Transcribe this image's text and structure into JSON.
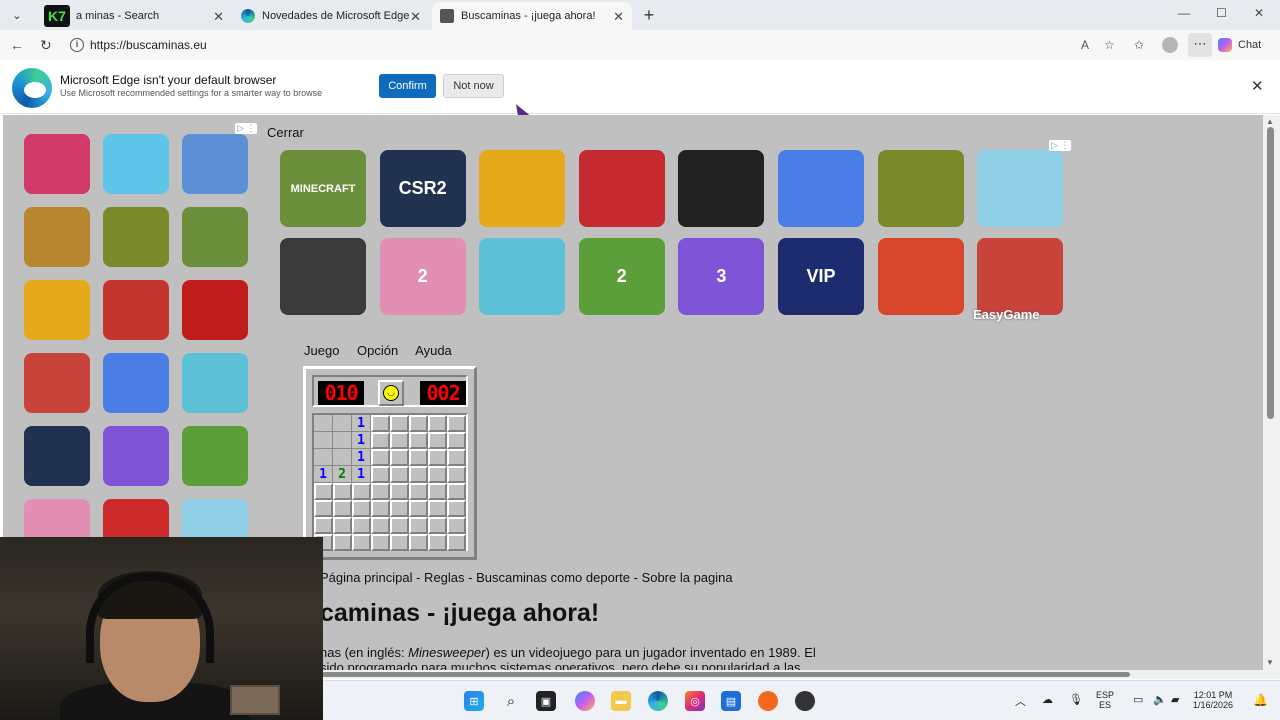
{
  "browser": {
    "tabs": [
      {
        "title": "a minas - Search",
        "logo_text": "K7"
      },
      {
        "title": "Novedades de Microsoft Edge"
      },
      {
        "title": "Buscaminas - ¡juega ahora!",
        "active": true
      }
    ],
    "url": "https://buscaminas.eu",
    "chat_label": "Chat"
  },
  "notification": {
    "title": "Microsoft Edge isn't your default browser",
    "subtitle": "Use Microsoft recommended settings for a smarter way to browse",
    "confirm_label": "Confirm",
    "not_now_label": "Not now"
  },
  "page": {
    "close_label": "Cerrar",
    "ad_brand": "EasyGame",
    "menu": [
      "Juego",
      "Opción",
      "Ayuda"
    ],
    "minesweeper": {
      "mines_counter": "010",
      "timer": "002",
      "rows": 8,
      "cols": 8,
      "opened_cells": [
        {
          "r": 0,
          "c": 0,
          "v": ""
        },
        {
          "r": 0,
          "c": 1,
          "v": ""
        },
        {
          "r": 0,
          "c": 2,
          "v": "1"
        },
        {
          "r": 1,
          "c": 0,
          "v": ""
        },
        {
          "r": 1,
          "c": 1,
          "v": ""
        },
        {
          "r": 1,
          "c": 2,
          "v": "1"
        },
        {
          "r": 2,
          "c": 0,
          "v": ""
        },
        {
          "r": 2,
          "c": 1,
          "v": ""
        },
        {
          "r": 2,
          "c": 2,
          "v": "1"
        },
        {
          "r": 3,
          "c": 0,
          "v": "1"
        },
        {
          "r": 3,
          "c": 1,
          "v": "2"
        },
        {
          "r": 3,
          "c": 2,
          "v": "1"
        }
      ],
      "number_colors": {
        "1": "#0000ff",
        "2": "#008000"
      }
    },
    "links": "Página principal - Reglas - Buscaminas como deporte - Sobre la pagina",
    "headline": "caminas - ¡juega ahora!",
    "paragraph_line1_a": "nas (en inglés: ",
    "paragraph_line1_em": "Minesweeper",
    "paragraph_line1_b": ") es un videojuego para un jugador inventado en 1989. El",
    "paragraph_line2": "sido programado para muchos sistemas operativos, pero debe su popularidad a las"
  },
  "sidebar_games": [
    {
      "name": "pokemon",
      "color": "#d23a6a"
    },
    {
      "name": "toca-world",
      "color": "#5fc5e8"
    },
    {
      "name": "hero-wars",
      "color": "#5b8fd6"
    },
    {
      "name": "clash-of-clans",
      "color": "#b8862e"
    },
    {
      "name": "temple-run",
      "color": "#7a8a2a"
    },
    {
      "name": "minecraft",
      "color": "#6b8f3a"
    },
    {
      "name": "geometry-dash",
      "color": "#e6a91a"
    },
    {
      "name": "free-fire",
      "color": "#c2362e"
    },
    {
      "name": "among-us",
      "color": "#c01c1c"
    },
    {
      "name": "subway-surfers",
      "color": "#c8443a"
    },
    {
      "name": "snake",
      "color": "#4a7ee6"
    },
    {
      "name": "archer",
      "color": "#5cc0d6"
    },
    {
      "name": "csr2",
      "color": "#20324f"
    },
    {
      "name": "piano-tiles-3",
      "color": "#7d55d6"
    },
    {
      "name": "hill-climb-2",
      "color": "#5b9e3a"
    },
    {
      "name": "talking-angela",
      "color": "#e38fb4"
    },
    {
      "name": "super-mario",
      "color": "#cc2a2a"
    },
    {
      "name": "toca-boca",
      "color": "#8fd0e6"
    }
  ],
  "ad_games": [
    {
      "name": "minecraft",
      "label": "MINECRAFT",
      "color": "#6b8f3a"
    },
    {
      "name": "csr2",
      "label": "CSR2",
      "color": "#20324f"
    },
    {
      "name": "geometry-dash",
      "label": "",
      "color": "#e6a91a"
    },
    {
      "name": "poppy-playtime",
      "label": "",
      "color": "#c52a30"
    },
    {
      "name": "roblox",
      "label": "",
      "color": "#222222"
    },
    {
      "name": "snake",
      "label": "",
      "color": "#4a7ee6"
    },
    {
      "name": "temple-run",
      "label": "",
      "color": "#7a8a2a"
    },
    {
      "name": "toca-boca",
      "label": "",
      "color": "#8fd0e6"
    },
    {
      "name": "sky-force",
      "label": "",
      "color": "#3a3a3a"
    },
    {
      "name": "talking-angela-2",
      "label": "2",
      "color": "#e38fb4"
    },
    {
      "name": "archer",
      "label": "",
      "color": "#5cc0d6"
    },
    {
      "name": "hill-climb-2",
      "label": "2",
      "color": "#5b9e3a"
    },
    {
      "name": "piano-tiles-3",
      "label": "3",
      "color": "#7d55d6"
    },
    {
      "name": "space-shooter",
      "label": "VIP",
      "color": "#1d2c6e"
    },
    {
      "name": "candy-crush",
      "label": "",
      "color": "#d8462b"
    },
    {
      "name": "subway-surfers",
      "label": "",
      "color": "#c8443a"
    }
  ],
  "taskbar": {
    "lang_top": "ESP",
    "lang_bottom": "ES",
    "time": "12:01 PM",
    "date": "1/16/2026"
  }
}
